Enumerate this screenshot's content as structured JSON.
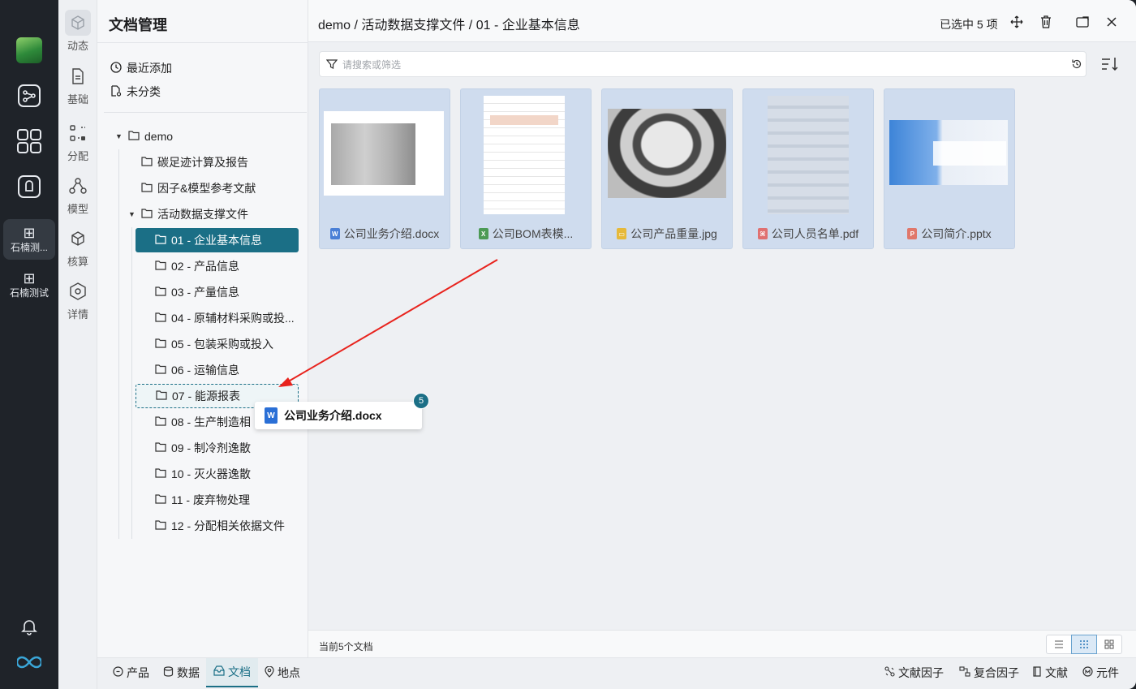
{
  "colors": {
    "accent": "#1b6f86",
    "arrow": "#e8231d",
    "card_bg": "#cfdcee"
  },
  "rail": {
    "apps": [
      {
        "label": "石楠测...",
        "icon": "grid-icon",
        "active": true
      },
      {
        "label": "石楠测试",
        "icon": "grid-icon",
        "active": false
      }
    ]
  },
  "nav2": {
    "items": [
      {
        "label": "动态",
        "icon": "cube-icon"
      },
      {
        "label": "基础",
        "icon": "file-icon"
      },
      {
        "label": "分配",
        "icon": "allocate-icon"
      },
      {
        "label": "模型",
        "icon": "model-icon"
      },
      {
        "label": "核算",
        "icon": "box-icon"
      },
      {
        "label": "详情",
        "icon": "hexagon-icon"
      }
    ]
  },
  "tree": {
    "title": "文档管理",
    "quick": {
      "recent": "最近添加",
      "uncategorized": "未分类"
    },
    "root": "demo",
    "folders": {
      "f1": "碳足迹计算及报告",
      "f2": "因子&模型参考文献",
      "f3": "活动数据支撑文件"
    },
    "sub": [
      "01 - 企业基本信息",
      "02 - 产品信息",
      "03 - 产量信息",
      "04 - 原辅材料采购或投...",
      "05 - 包装采购或投入",
      "06 - 运输信息",
      "07 - 能源报表",
      "08 - 生产制造相",
      "09 - 制冷剂逸散",
      "10 - 灭火器逸散",
      "11 - 废弃物处理",
      "12 - 分配相关依据文件"
    ]
  },
  "header": {
    "breadcrumb": "demo / 活动数据支撑文件 / 01 - 企业基本信息",
    "selection": "已选中 5 项"
  },
  "search": {
    "placeholder": "请搜索或筛选",
    "value": ""
  },
  "files": [
    {
      "name": "公司业务介绍.docx",
      "tag": "W",
      "tag_color": "#4a7fd6"
    },
    {
      "name": "公司BOM表模...",
      "tag": "X",
      "tag_color": "#4c9a55"
    },
    {
      "name": "公司产品重量.jpg",
      "tag": "▭",
      "tag_color": "#e6b93a"
    },
    {
      "name": "公司人员名单.pdf",
      "tag": "⌘",
      "tag_color": "#e07070"
    },
    {
      "name": "公司简介.pptx",
      "tag": "P",
      "tag_color": "#e0776a"
    }
  ],
  "status": {
    "count_text": "当前5个文档"
  },
  "bottom_tabs": {
    "left": [
      {
        "label": "产品",
        "icon": "product-icon"
      },
      {
        "label": "数据",
        "icon": "data-icon"
      },
      {
        "label": "文档",
        "icon": "doc-icon",
        "active": true
      },
      {
        "label": "地点",
        "icon": "location-icon"
      }
    ],
    "right": [
      {
        "label": "文献因子",
        "icon": "literature-factor-icon"
      },
      {
        "label": "复合因子",
        "icon": "composite-factor-icon"
      },
      {
        "label": "文献",
        "icon": "literature-icon"
      },
      {
        "label": "元件",
        "icon": "component-icon"
      }
    ]
  },
  "drag": {
    "file_name": "公司业务介绍.docx",
    "count": "5"
  }
}
